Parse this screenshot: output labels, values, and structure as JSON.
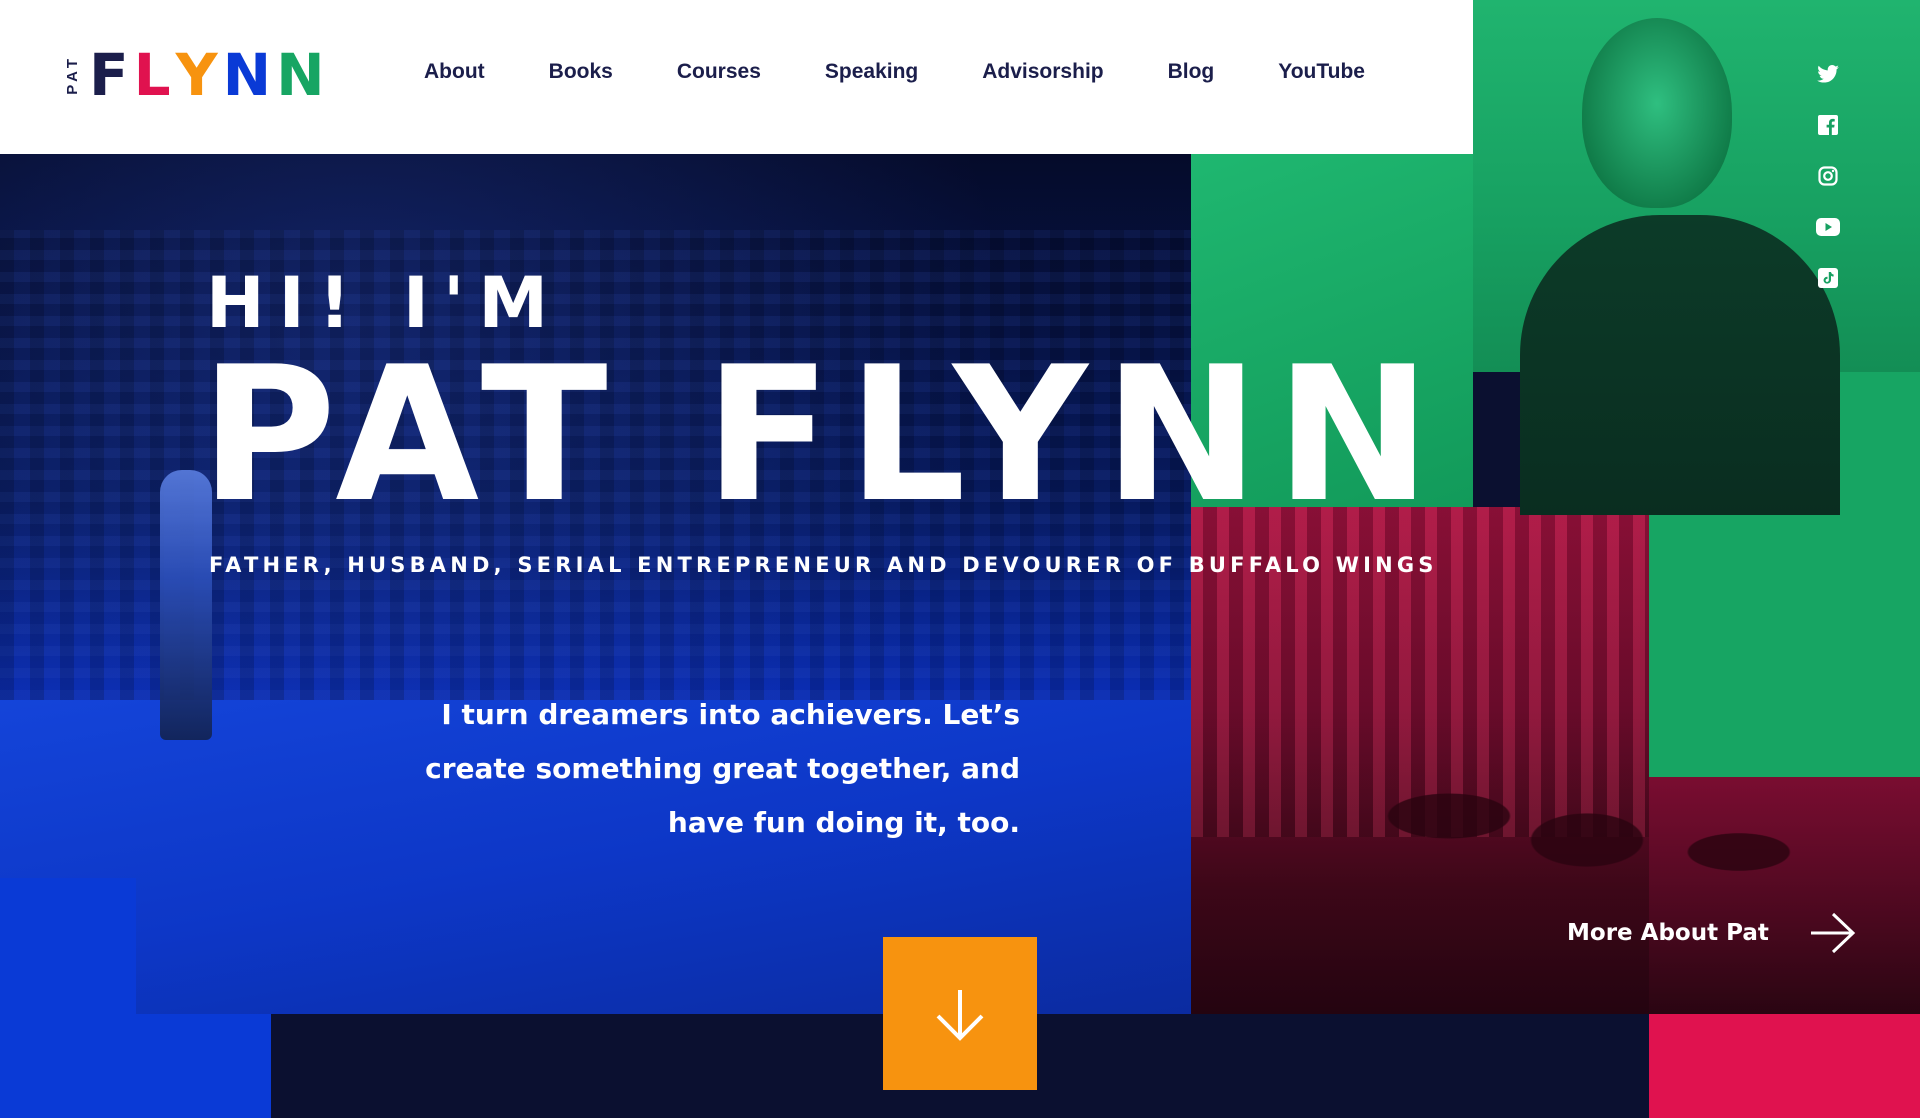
{
  "logo": {
    "small_text": "PAT",
    "letters": [
      {
        "char": "F",
        "color": "#1b1e4b"
      },
      {
        "char": "L",
        "color": "#e0124f"
      },
      {
        "char": "Y",
        "color": "#f7930f"
      },
      {
        "char": "N",
        "color": "#0a3ad6"
      },
      {
        "char": "N",
        "color": "#17a563"
      }
    ]
  },
  "nav": {
    "items": [
      {
        "label": "About"
      },
      {
        "label": "Books"
      },
      {
        "label": "Courses"
      },
      {
        "label": "Speaking"
      },
      {
        "label": "Advisorship"
      },
      {
        "label": "Blog"
      },
      {
        "label": "YouTube"
      }
    ]
  },
  "social": [
    "twitter-icon",
    "facebook-icon",
    "instagram-icon",
    "youtube-icon",
    "tiktok-icon"
  ],
  "hero": {
    "greeting": "HI! I'M",
    "name": "PAT FLYNN",
    "tagline": "FATHER, HUSBAND, SERIAL ENTREPRENEUR AND DEVOURER OF BUFFALO WINGS",
    "mission_lines": [
      "I turn dreamers into achievers. Let’s",
      "create something great together, and",
      "have fun doing it, too."
    ],
    "more_label": "More About Pat"
  },
  "colors": {
    "navy": "#1b1e4b",
    "pink": "#e0124f",
    "orange": "#f7930f",
    "blue": "#0a3ad6",
    "green": "#17a563"
  }
}
